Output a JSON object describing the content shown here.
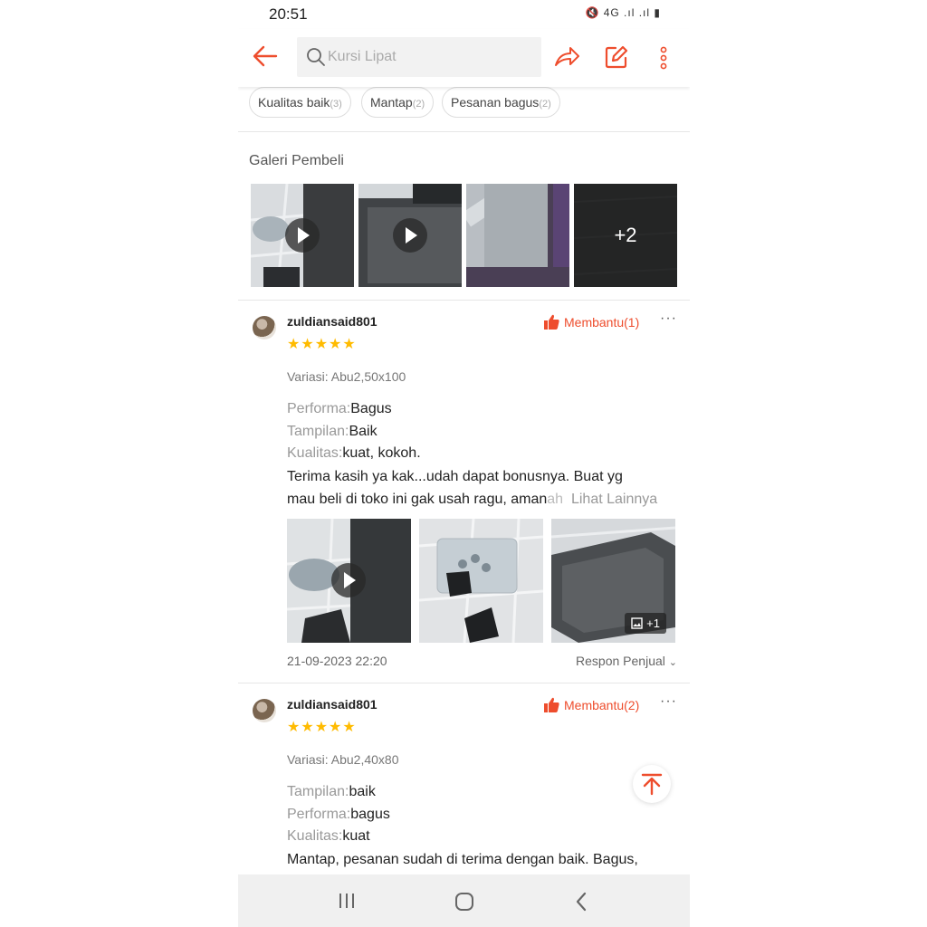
{
  "status": {
    "time": "20:51",
    "icons": "🔇 4G .ıl .ıl ▮"
  },
  "search": {
    "placeholder": "Kursi Lipat"
  },
  "chips": [
    {
      "label": "Kualitas baik",
      "count": "(3)"
    },
    {
      "label": "Mantap",
      "count": "(2)"
    },
    {
      "label": "Pesanan bagus",
      "count": "(2)"
    }
  ],
  "gallery": {
    "title": "Galeri Pembeli",
    "more": "+2"
  },
  "reviews": [
    {
      "user": "zuldiansaid801",
      "helpful": "Membantu(1)",
      "stars": "★★★★★",
      "variasi": "Variasi: Abu2,50x100",
      "attrs": [
        {
          "k": "Performa:",
          "v": "Bagus"
        },
        {
          "k": "Tampilan:",
          "v": "Baik"
        },
        {
          "k": "Kualitas:",
          "v": "kuat, kokoh."
        }
      ],
      "body_line1": "Terima kasih ya kak...udah dapat bonusnya. Buat yg",
      "body_line2": "mau beli di toko ini gak usah ragu, aman",
      "body_fade": "ah",
      "see_more": "Lihat Lainnya",
      "media_more": "+1",
      "date": "21-09-2023 22:20",
      "respon": "Respon Penjual"
    },
    {
      "user": "zuldiansaid801",
      "helpful": "Membantu(2)",
      "stars": "★★★★★",
      "variasi": "Variasi: Abu2,40x80",
      "attrs": [
        {
          "k": "Tampilan:",
          "v": "baik"
        },
        {
          "k": "Performa:",
          "v": "bagus"
        },
        {
          "k": "Kualitas:",
          "v": "kuat"
        }
      ],
      "body_line1": "Mantap, pesanan sudah di terima dengan baik. Bagus,"
    }
  ],
  "colors": {
    "accent": "#ee4d2d",
    "star": "#ffbb00"
  }
}
